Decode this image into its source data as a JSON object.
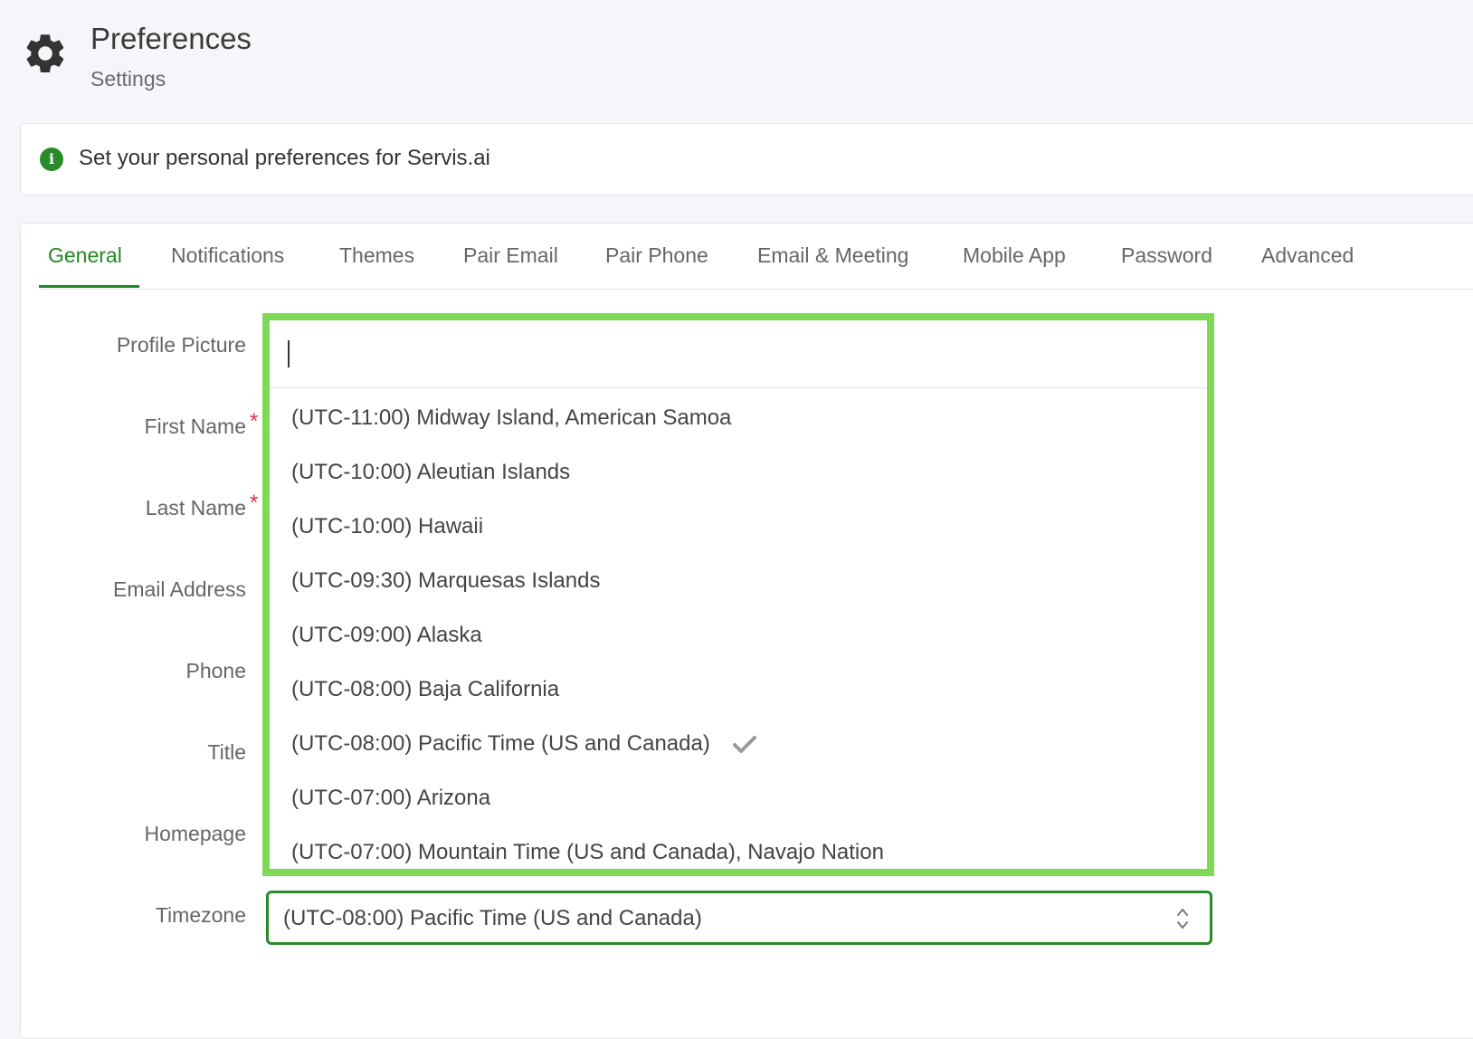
{
  "header": {
    "title": "Preferences",
    "subtitle": "Settings",
    "icon": "gear-icon"
  },
  "info": {
    "icon": "info-icon",
    "icon_glyph": "i",
    "text": "Set your personal preferences for Servis.ai"
  },
  "tabs": [
    {
      "label": "General",
      "active": true
    },
    {
      "label": "Notifications",
      "active": false
    },
    {
      "label": "Themes",
      "active": false
    },
    {
      "label": "Pair Email",
      "active": false
    },
    {
      "label": "Pair Phone",
      "active": false
    },
    {
      "label": "Email & Meeting",
      "active": false
    },
    {
      "label": "Mobile App",
      "active": false
    },
    {
      "label": "Password",
      "active": false
    },
    {
      "label": "Advanced",
      "active": false
    }
  ],
  "form": {
    "labels": {
      "profile_picture": "Profile Picture",
      "first_name": "First Name",
      "last_name": "Last Name",
      "email": "Email Address",
      "phone": "Phone",
      "title": "Title",
      "homepage": "Homepage",
      "timezone": "Timezone"
    },
    "required_marker": "*"
  },
  "timezone_dropdown": {
    "search_value": "",
    "options": [
      {
        "label": "(UTC-11:00) Midway Island, American Samoa",
        "selected": false
      },
      {
        "label": "(UTC-10:00) Aleutian Islands",
        "selected": false
      },
      {
        "label": "(UTC-10:00) Hawaii",
        "selected": false
      },
      {
        "label": "(UTC-09:30) Marquesas Islands",
        "selected": false
      },
      {
        "label": "(UTC-09:00) Alaska",
        "selected": false
      },
      {
        "label": "(UTC-08:00) Baja California",
        "selected": false
      },
      {
        "label": "(UTC-08:00) Pacific Time (US and Canada)",
        "selected": true
      },
      {
        "label": "(UTC-07:00) Arizona",
        "selected": false
      },
      {
        "label": "(UTC-07:00) Mountain Time (US and Canada), Navajo Nation",
        "selected": false
      }
    ],
    "selected_value": "(UTC-08:00) Pacific Time (US and Canada)"
  },
  "colors": {
    "accent_green": "#1f8a1f",
    "highlight_border": "#7ed957",
    "required_red": "#e0305a"
  }
}
